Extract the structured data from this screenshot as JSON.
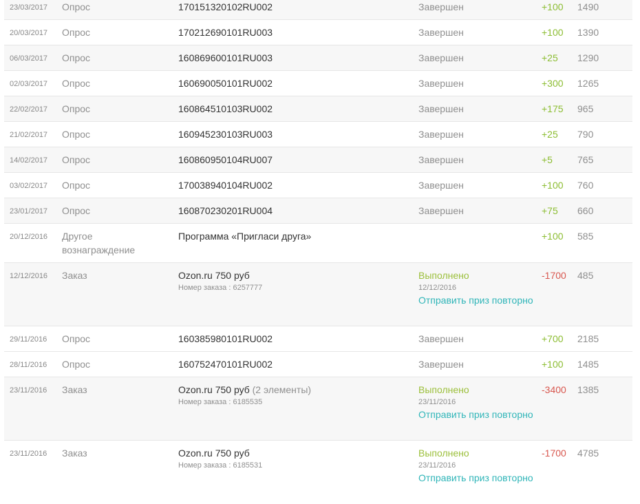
{
  "colors": {
    "positive": "#8cbd32",
    "negative": "#d8574f",
    "completed": "#9bbf3a",
    "link": "#2fb5b8",
    "muted": "#8f8f8f",
    "row_alt": "#f7f7f7"
  },
  "rows": [
    {
      "date": "23/03/2017",
      "type": "Опрос",
      "desc": "170151320102RU002",
      "status": "Завершен",
      "points": "+100",
      "balance": "1490"
    },
    {
      "date": "20/03/2017",
      "type": "Опрос",
      "desc": "170212690101RU003",
      "status": "Завершен",
      "points": "+100",
      "balance": "1390"
    },
    {
      "date": "06/03/2017",
      "type": "Опрос",
      "desc": "160869600101RU003",
      "status": "Завершен",
      "points": "+25",
      "balance": "1290"
    },
    {
      "date": "02/03/2017",
      "type": "Опрос",
      "desc": "160690050101RU002",
      "status": "Завершен",
      "points": "+300",
      "balance": "1265"
    },
    {
      "date": "22/02/2017",
      "type": "Опрос",
      "desc": "160864510103RU002",
      "status": "Завершен",
      "points": "+175",
      "balance": "965"
    },
    {
      "date": "21/02/2017",
      "type": "Опрос",
      "desc": "160945230103RU003",
      "status": "Завершен",
      "points": "+25",
      "balance": "790"
    },
    {
      "date": "14/02/2017",
      "type": "Опрос",
      "desc": "160860950104RU007",
      "status": "Завершен",
      "points": "+5",
      "balance": "765"
    },
    {
      "date": "03/02/2017",
      "type": "Опрос",
      "desc": "170038940104RU002",
      "status": "Завершен",
      "points": "+100",
      "balance": "760"
    },
    {
      "date": "23/01/2017",
      "type": "Опрос",
      "desc": "160870230201RU004",
      "status": "Завершен",
      "points": "+75",
      "balance": "660"
    },
    {
      "date": "20/12/2016",
      "type": "Другое вознаграждение",
      "desc": "Программа «Пригласи друга»",
      "status": "",
      "points": "+100",
      "balance": "585"
    },
    {
      "date": "12/12/2016",
      "type": "Заказ",
      "desc": "Ozon.ru 750 руб",
      "desc_sub": "Номер заказа : 6257777",
      "status": "Выполнено",
      "status_date": "12/12/2016",
      "resend": "Отправить приз повторно",
      "points": "-1700",
      "balance": "485"
    },
    {
      "date": "29/11/2016",
      "type": "Опрос",
      "desc": "160385980101RU002",
      "status": "Завершен",
      "points": "+700",
      "balance": "2185"
    },
    {
      "date": "28/11/2016",
      "type": "Опрос",
      "desc": "160752470101RU002",
      "status": "Завершен",
      "points": "+100",
      "balance": "1485"
    },
    {
      "date": "23/11/2016",
      "type": "Заказ",
      "desc": "Ozon.ru 750 руб",
      "desc_count": "(2 элементы)",
      "desc_sub": "Номер заказа : 6185535",
      "status": "Выполнено",
      "status_date": "23/11/2016",
      "resend": "Отправить приз повторно",
      "points": "-3400",
      "balance": "1385"
    },
    {
      "date": "23/11/2016",
      "type": "Заказ",
      "desc": "Ozon.ru 750 руб",
      "desc_sub": "Номер заказа : 6185531",
      "status": "Выполнено",
      "status_date": "23/11/2016",
      "resend": "Отправить приз повторно",
      "points": "-1700",
      "balance": "4785"
    }
  ]
}
